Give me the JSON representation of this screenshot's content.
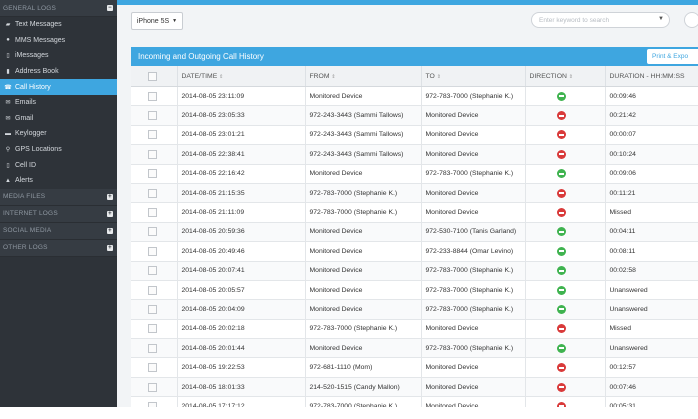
{
  "sidebar": {
    "general_logs": "GENERAL LOGS",
    "items": [
      {
        "label": "Text Messages",
        "icon": "chat-icon",
        "glyph": "▰"
      },
      {
        "label": "MMS Messages",
        "icon": "mms-icon",
        "glyph": "●"
      },
      {
        "label": "iMessages",
        "icon": "imessage-icon",
        "glyph": "▯"
      },
      {
        "label": "Address Book",
        "icon": "address-book-icon",
        "glyph": "▮"
      },
      {
        "label": "Call History",
        "icon": "phone-icon",
        "glyph": "☎",
        "active": true
      },
      {
        "label": "Emails",
        "icon": "email-icon",
        "glyph": "✉"
      },
      {
        "label": "Gmail",
        "icon": "gmail-icon",
        "glyph": "✉"
      },
      {
        "label": "Keylogger",
        "icon": "keyboard-icon",
        "glyph": "▬"
      },
      {
        "label": "GPS Locations",
        "icon": "map-pin-icon",
        "glyph": "⚲"
      },
      {
        "label": "Cell ID",
        "icon": "cell-tower-icon",
        "glyph": "▯"
      },
      {
        "label": "Alerts",
        "icon": "alert-icon",
        "glyph": "▲"
      }
    ],
    "media_files": "MEDIA FILES",
    "internet_logs": "INTERNET LOGS",
    "social_media": "SOCIAL MEDIA",
    "other_logs": "OTHER LOGS"
  },
  "toolbar": {
    "device": "iPhone 5S",
    "search_placeholder": "Enter keyword to search"
  },
  "panel": {
    "title": "Incoming and Outgoing Call History",
    "print_label": "Print & Expo"
  },
  "table": {
    "headers": [
      "DATE/TIME",
      "FROM",
      "TO",
      "DIRECTION",
      "DURATION - HH:MM:SS"
    ],
    "rows": [
      {
        "date": "2014-08-05 23:11:09",
        "from": "Monitored Device",
        "to": "972-783-7000 (Stephanie K.)",
        "dir": "out",
        "duration": "00:09:46"
      },
      {
        "date": "2014-08-05 23:05:33",
        "from": "972-243-3443 (Sammi Tallows)",
        "to": "Monitored Device",
        "dir": "in",
        "duration": "00:21:42"
      },
      {
        "date": "2014-08-05 23:01:21",
        "from": "972-243-3443 (Sammi Tallows)",
        "to": "Monitored Device",
        "dir": "in",
        "duration": "00:00:07"
      },
      {
        "date": "2014-08-05 22:38:41",
        "from": "972-243-3443 (Sammi Tallows)",
        "to": "Monitored Device",
        "dir": "in",
        "duration": "00:10:24"
      },
      {
        "date": "2014-08-05 22:16:42",
        "from": "Monitored Device",
        "to": "972-783-7000 (Stephanie K.)",
        "dir": "out",
        "duration": "00:09:06"
      },
      {
        "date": "2014-08-05 21:15:35",
        "from": "972-783-7000 (Stephanie K.)",
        "to": "Monitored Device",
        "dir": "in",
        "duration": "00:11:21"
      },
      {
        "date": "2014-08-05 21:11:09",
        "from": "972-783-7000 (Stephanie K.)",
        "to": "Monitored Device",
        "dir": "in",
        "duration": "Missed"
      },
      {
        "date": "2014-08-05 20:59:36",
        "from": "Monitored Device",
        "to": "972-530-7100 (Tanis Garland)",
        "dir": "out",
        "duration": "00:04:11"
      },
      {
        "date": "2014-08-05 20:49:46",
        "from": "Monitored Device",
        "to": "972-233-8844 (Omar Levino)",
        "dir": "out",
        "duration": "00:08:11"
      },
      {
        "date": "2014-08-05 20:07:41",
        "from": "Monitored Device",
        "to": "972-783-7000 (Stephanie K.)",
        "dir": "out",
        "duration": "00:02:58"
      },
      {
        "date": "2014-08-05 20:05:57",
        "from": "Monitored Device",
        "to": "972-783-7000 (Stephanie K.)",
        "dir": "out",
        "duration": "Unanswered"
      },
      {
        "date": "2014-08-05 20:04:09",
        "from": "Monitored Device",
        "to": "972-783-7000 (Stephanie K.)",
        "dir": "out",
        "duration": "Unanswered"
      },
      {
        "date": "2014-08-05 20:02:18",
        "from": "972-783-7000 (Stephanie K.)",
        "to": "Monitored Device",
        "dir": "in",
        "duration": "Missed"
      },
      {
        "date": "2014-08-05 20:01:44",
        "from": "Monitored Device",
        "to": "972-783-7000 (Stephanie K.)",
        "dir": "out",
        "duration": "Unanswered"
      },
      {
        "date": "2014-08-05 19:22:53",
        "from": "972-681-1110 (Mom)",
        "to": "Monitored Device",
        "dir": "in",
        "duration": "00:12:57"
      },
      {
        "date": "2014-08-05 18:01:33",
        "from": "214-520-1515 (Candy Mallon)",
        "to": "Monitored Device",
        "dir": "in",
        "duration": "00:07:46"
      },
      {
        "date": "2014-08-05 17:17:12",
        "from": "972-783-7000 (Stephanie K.)",
        "to": "Monitored Device",
        "dir": "in",
        "duration": "00:05:31"
      }
    ]
  },
  "colors": {
    "accent": "#3ea6e0",
    "sidebar": "#2e3339",
    "incoming": "#d93a3a",
    "outgoing": "#3fb34f"
  }
}
